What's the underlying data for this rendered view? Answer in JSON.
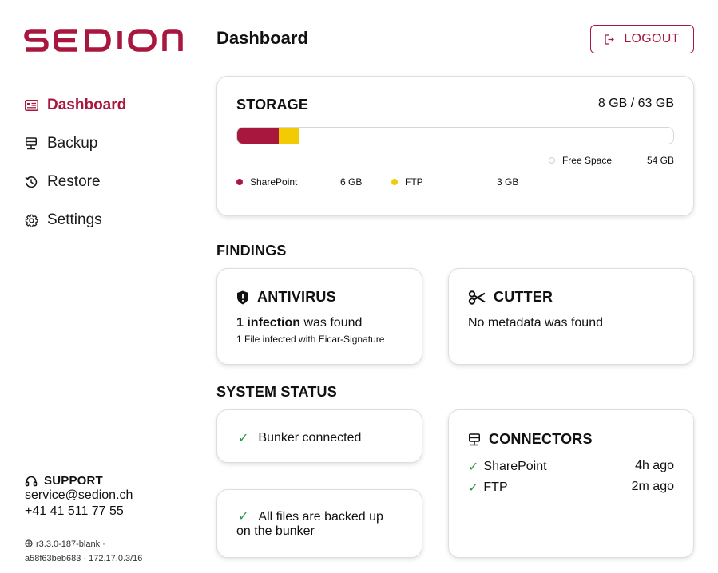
{
  "brand": {
    "name": "sedion",
    "color": "#a8173e"
  },
  "page": {
    "title": "Dashboard"
  },
  "header": {
    "logout_label": "LOGOUT"
  },
  "nav": {
    "items": [
      {
        "label": "Dashboard",
        "icon": "dashboard-icon",
        "active": true
      },
      {
        "label": "Backup",
        "icon": "backup-icon",
        "active": false
      },
      {
        "label": "Restore",
        "icon": "restore-icon",
        "active": false
      },
      {
        "label": "Settings",
        "icon": "gear-icon",
        "active": false
      }
    ]
  },
  "support": {
    "title": "SUPPORT",
    "email": "service@sedion.ch",
    "phone": "+41 41 511 77 55",
    "version_line1": "r3.3.0-187-blank ·",
    "version_line2": "a58f63beb683 · 172.17.0.3/16"
  },
  "storage": {
    "title": "STORAGE",
    "total": "8 GB / 63 GB",
    "segments": [
      {
        "name": "SharePoint",
        "value": 6,
        "display": "6 GB",
        "color": "#a8173e"
      },
      {
        "name": "FTP",
        "value": 3,
        "display": "3 GB",
        "color": "#f2cb05"
      }
    ],
    "capacity": 63,
    "free": {
      "name": "Free Space",
      "display": "54 GB"
    }
  },
  "findings": {
    "title": "FINDINGS",
    "antivirus": {
      "title": "ANTIVIRUS",
      "main_bold": "1 infection",
      "main_rest": " was found",
      "sub": "1 File infected with Eicar-Signature"
    },
    "cutter": {
      "title": "CUTTER",
      "main": "No metadata was found"
    }
  },
  "system_status": {
    "title": "SYSTEM STATUS",
    "bunker": "Bunker connected",
    "backup_line1": "All files are backed up",
    "backup_line2": "on the bunker",
    "connectors": {
      "title": "CONNECTORS",
      "items": [
        {
          "name": "SharePoint",
          "time": "4h ago"
        },
        {
          "name": "FTP",
          "time": "2m ago"
        }
      ]
    }
  },
  "colors": {
    "accent": "#a8173e",
    "ftp": "#f2cb05",
    "check": "#2e9a44"
  }
}
